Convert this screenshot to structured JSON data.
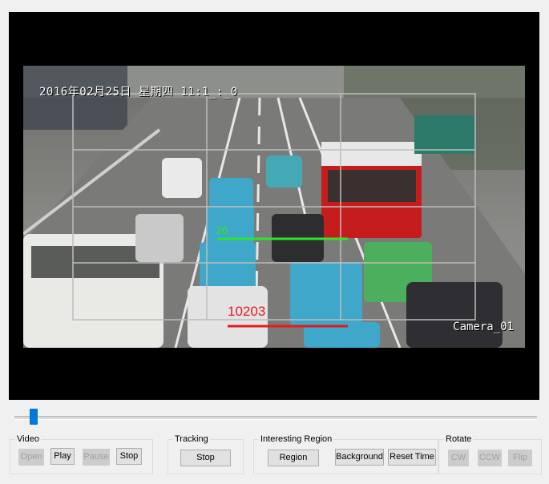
{
  "video": {
    "timestamp_overlay": "2016年02月25日  星期四  11:1_:_0",
    "camera_label": "Camera_01",
    "line_count_green": "26",
    "line_count_red": "10203"
  },
  "seek_slider": {
    "position_fraction": 0.03
  },
  "groups": {
    "video": {
      "title": "Video",
      "open": "Open",
      "open_enabled": false,
      "play": "Play",
      "play_enabled": true,
      "pause": "Pause",
      "pause_enabled": false,
      "stop": "Stop",
      "stop_enabled": true
    },
    "tracking": {
      "title": "Tracking",
      "stop": "Stop"
    },
    "interesting_region": {
      "title": "Interesting Region",
      "region": "Region",
      "background": "Background",
      "reset_time": "Reset Time"
    },
    "rotate": {
      "title": "Rotate",
      "cw": "CW",
      "cw_enabled": false,
      "ccw": "CCW",
      "ccw_enabled": false,
      "flip": "Flip",
      "flip_enabled": false
    }
  },
  "colors": {
    "video_background": "#000000",
    "count_line_green": "#2ee62e",
    "count_line_red": "#e21b1b",
    "slider_thumb": "#0078d7"
  }
}
